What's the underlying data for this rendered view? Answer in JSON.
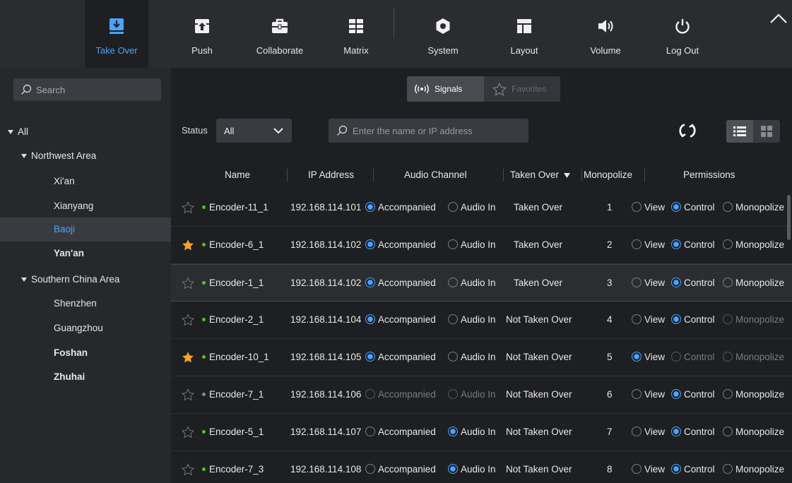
{
  "toolbar": {
    "take_over": "Take Over",
    "push": "Push",
    "collaborate": "Collaborate",
    "matrix": "Matrix",
    "system": "System",
    "layout": "Layout",
    "volume": "Volume",
    "log_out": "Log Out"
  },
  "sidebar": {
    "search_placeholder": "Search",
    "tree": {
      "all": "All",
      "northwest": "Northwest Area",
      "xian": "Xi'an",
      "xianyang": "Xianyang",
      "baoji": "Baoji",
      "yanan": "Yan'an",
      "southern": "Southern China Area",
      "shenzhen": "Shenzhen",
      "guangzhou": "Guangzhou",
      "foshan": "Foshan",
      "zhuhai": "Zhuhai"
    }
  },
  "main": {
    "signals_tab": "Signals",
    "favorites_tab": "Favorites",
    "status_label": "Status",
    "status_value": "All",
    "search_placeholder": "Enter the name or IP address",
    "columns": {
      "name": "Name",
      "ip": "IP Address",
      "audio": "Audio Channel",
      "taken": "Taken Over",
      "mono": "Monopolize",
      "perm": "Permissions"
    },
    "labels": {
      "accompanied": "Accompanied",
      "audio_in": "Audio In",
      "view": "View",
      "control": "Control",
      "monopolize": "Monopolize"
    },
    "rows": [
      {
        "name": "Encoder-11_1",
        "ip": "192.168.114.101",
        "taken": "Taken Over",
        "mono": "1"
      },
      {
        "name": "Encoder-6_1",
        "ip": "192.168.114.102",
        "taken": "Taken Over",
        "mono": "2"
      },
      {
        "name": "Encoder-1_1",
        "ip": "192.168.114.102",
        "taken": "Taken Over",
        "mono": "3"
      },
      {
        "name": "Encoder-2_1",
        "ip": "192.168.114.104",
        "taken": "Not Taken Over",
        "mono": "4"
      },
      {
        "name": "Encoder-10_1",
        "ip": "192.168.114.105",
        "taken": "Not Taken Over",
        "mono": "5"
      },
      {
        "name": "Encoder-7_1",
        "ip": "192.168.114.106",
        "taken": "Not Taken Over",
        "mono": "6"
      },
      {
        "name": "Encoder-5_1",
        "ip": "192.168.114.107",
        "taken": "Not Taken Over",
        "mono": "7"
      },
      {
        "name": "Encoder-7_3",
        "ip": "192.168.114.108",
        "taken": "Not Taken Over",
        "mono": "8"
      }
    ]
  },
  "colors": {
    "accent": "#4aa3ff",
    "star": "#f5a623",
    "online": "#52c41a"
  }
}
